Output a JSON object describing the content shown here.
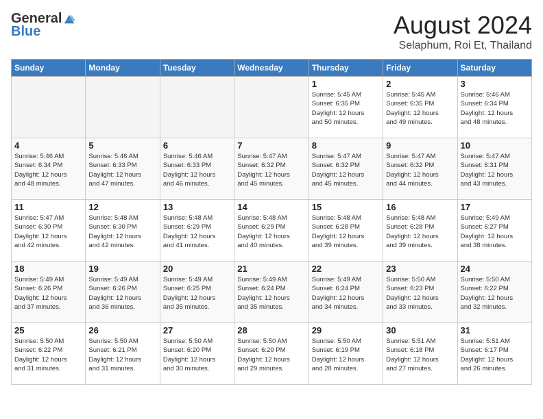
{
  "header": {
    "logo_general": "General",
    "logo_blue": "Blue",
    "month_year": "August 2024",
    "location": "Selaphum, Roi Et, Thailand"
  },
  "weekdays": [
    "Sunday",
    "Monday",
    "Tuesday",
    "Wednesday",
    "Thursday",
    "Friday",
    "Saturday"
  ],
  "weeks": [
    [
      {
        "day": "",
        "text": ""
      },
      {
        "day": "",
        "text": ""
      },
      {
        "day": "",
        "text": ""
      },
      {
        "day": "",
        "text": ""
      },
      {
        "day": "1",
        "text": "Sunrise: 5:45 AM\nSunset: 6:35 PM\nDaylight: 12 hours\nand 50 minutes."
      },
      {
        "day": "2",
        "text": "Sunrise: 5:45 AM\nSunset: 6:35 PM\nDaylight: 12 hours\nand 49 minutes."
      },
      {
        "day": "3",
        "text": "Sunrise: 5:46 AM\nSunset: 6:34 PM\nDaylight: 12 hours\nand 48 minutes."
      }
    ],
    [
      {
        "day": "4",
        "text": "Sunrise: 5:46 AM\nSunset: 6:34 PM\nDaylight: 12 hours\nand 48 minutes."
      },
      {
        "day": "5",
        "text": "Sunrise: 5:46 AM\nSunset: 6:33 PM\nDaylight: 12 hours\nand 47 minutes."
      },
      {
        "day": "6",
        "text": "Sunrise: 5:46 AM\nSunset: 6:33 PM\nDaylight: 12 hours\nand 46 minutes."
      },
      {
        "day": "7",
        "text": "Sunrise: 5:47 AM\nSunset: 6:32 PM\nDaylight: 12 hours\nand 45 minutes."
      },
      {
        "day": "8",
        "text": "Sunrise: 5:47 AM\nSunset: 6:32 PM\nDaylight: 12 hours\nand 45 minutes."
      },
      {
        "day": "9",
        "text": "Sunrise: 5:47 AM\nSunset: 6:32 PM\nDaylight: 12 hours\nand 44 minutes."
      },
      {
        "day": "10",
        "text": "Sunrise: 5:47 AM\nSunset: 6:31 PM\nDaylight: 12 hours\nand 43 minutes."
      }
    ],
    [
      {
        "day": "11",
        "text": "Sunrise: 5:47 AM\nSunset: 6:30 PM\nDaylight: 12 hours\nand 42 minutes."
      },
      {
        "day": "12",
        "text": "Sunrise: 5:48 AM\nSunset: 6:30 PM\nDaylight: 12 hours\nand 42 minutes."
      },
      {
        "day": "13",
        "text": "Sunrise: 5:48 AM\nSunset: 6:29 PM\nDaylight: 12 hours\nand 41 minutes."
      },
      {
        "day": "14",
        "text": "Sunrise: 5:48 AM\nSunset: 6:29 PM\nDaylight: 12 hours\nand 40 minutes."
      },
      {
        "day": "15",
        "text": "Sunrise: 5:48 AM\nSunset: 6:28 PM\nDaylight: 12 hours\nand 39 minutes."
      },
      {
        "day": "16",
        "text": "Sunrise: 5:48 AM\nSunset: 6:28 PM\nDaylight: 12 hours\nand 39 minutes."
      },
      {
        "day": "17",
        "text": "Sunrise: 5:49 AM\nSunset: 6:27 PM\nDaylight: 12 hours\nand 38 minutes."
      }
    ],
    [
      {
        "day": "18",
        "text": "Sunrise: 5:49 AM\nSunset: 6:26 PM\nDaylight: 12 hours\nand 37 minutes."
      },
      {
        "day": "19",
        "text": "Sunrise: 5:49 AM\nSunset: 6:26 PM\nDaylight: 12 hours\nand 36 minutes."
      },
      {
        "day": "20",
        "text": "Sunrise: 5:49 AM\nSunset: 6:25 PM\nDaylight: 12 hours\nand 35 minutes."
      },
      {
        "day": "21",
        "text": "Sunrise: 5:49 AM\nSunset: 6:24 PM\nDaylight: 12 hours\nand 35 minutes."
      },
      {
        "day": "22",
        "text": "Sunrise: 5:49 AM\nSunset: 6:24 PM\nDaylight: 12 hours\nand 34 minutes."
      },
      {
        "day": "23",
        "text": "Sunrise: 5:50 AM\nSunset: 6:23 PM\nDaylight: 12 hours\nand 33 minutes."
      },
      {
        "day": "24",
        "text": "Sunrise: 5:50 AM\nSunset: 6:22 PM\nDaylight: 12 hours\nand 32 minutes."
      }
    ],
    [
      {
        "day": "25",
        "text": "Sunrise: 5:50 AM\nSunset: 6:22 PM\nDaylight: 12 hours\nand 31 minutes."
      },
      {
        "day": "26",
        "text": "Sunrise: 5:50 AM\nSunset: 6:21 PM\nDaylight: 12 hours\nand 31 minutes."
      },
      {
        "day": "27",
        "text": "Sunrise: 5:50 AM\nSunset: 6:20 PM\nDaylight: 12 hours\nand 30 minutes."
      },
      {
        "day": "28",
        "text": "Sunrise: 5:50 AM\nSunset: 6:20 PM\nDaylight: 12 hours\nand 29 minutes."
      },
      {
        "day": "29",
        "text": "Sunrise: 5:50 AM\nSunset: 6:19 PM\nDaylight: 12 hours\nand 28 minutes."
      },
      {
        "day": "30",
        "text": "Sunrise: 5:51 AM\nSunset: 6:18 PM\nDaylight: 12 hours\nand 27 minutes."
      },
      {
        "day": "31",
        "text": "Sunrise: 5:51 AM\nSunset: 6:17 PM\nDaylight: 12 hours\nand 26 minutes."
      }
    ]
  ]
}
